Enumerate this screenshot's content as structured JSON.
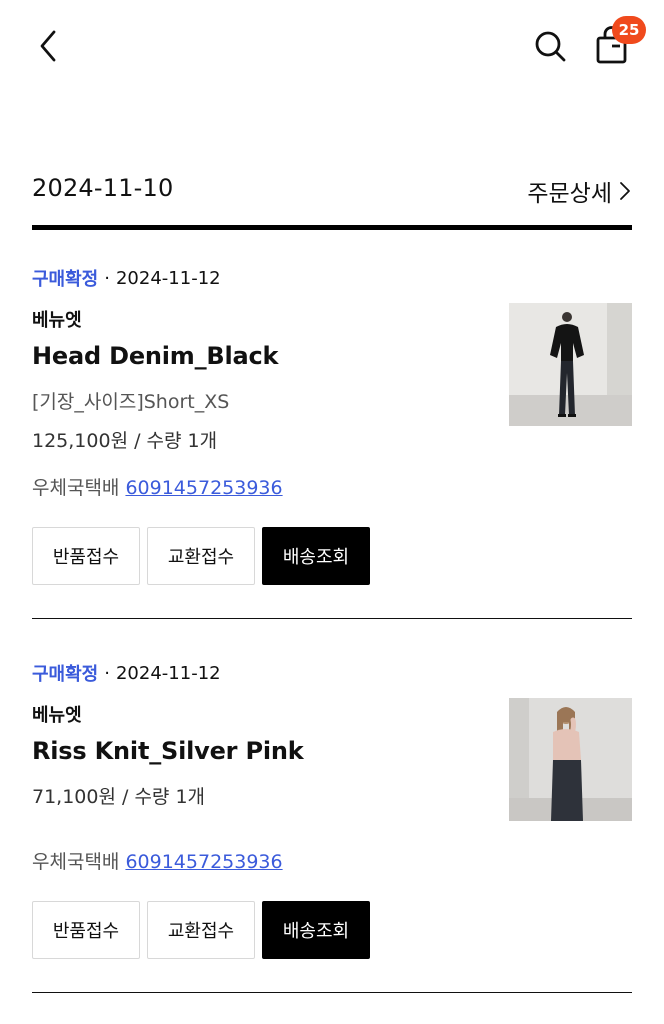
{
  "header": {
    "back_icon": "chevron-left-icon",
    "search_icon": "search-icon",
    "bag_icon": "shopping-bag-icon",
    "bag_count": "25",
    "badge_color": "#f04a1d"
  },
  "order": {
    "date": "2024-11-10",
    "detail_label": "주문상세"
  },
  "colors": {
    "status": "#3b5bdb",
    "link": "#3b5bdb"
  },
  "items": [
    {
      "status": "구매확정",
      "separator": "·",
      "status_date": "2024-11-12",
      "brand": "베뉴엣",
      "name": "Head Denim_Black",
      "option": "[기장_사이즈]Short_XS",
      "price": "125,100원 / 수량 1개",
      "carrier": "우체국택배",
      "tracking": "6091457253936",
      "buttons": {
        "return": "반품접수",
        "exchange": "교환접수",
        "track": "배송조회"
      }
    },
    {
      "status": "구매확정",
      "separator": "·",
      "status_date": "2024-11-12",
      "brand": "베뉴엣",
      "name": "Riss Knit_Silver Pink",
      "price": "71,100원 / 수량 1개",
      "carrier": "우체국택배",
      "tracking": "6091457253936",
      "buttons": {
        "return": "반품접수",
        "exchange": "교환접수",
        "track": "배송조회"
      }
    }
  ]
}
